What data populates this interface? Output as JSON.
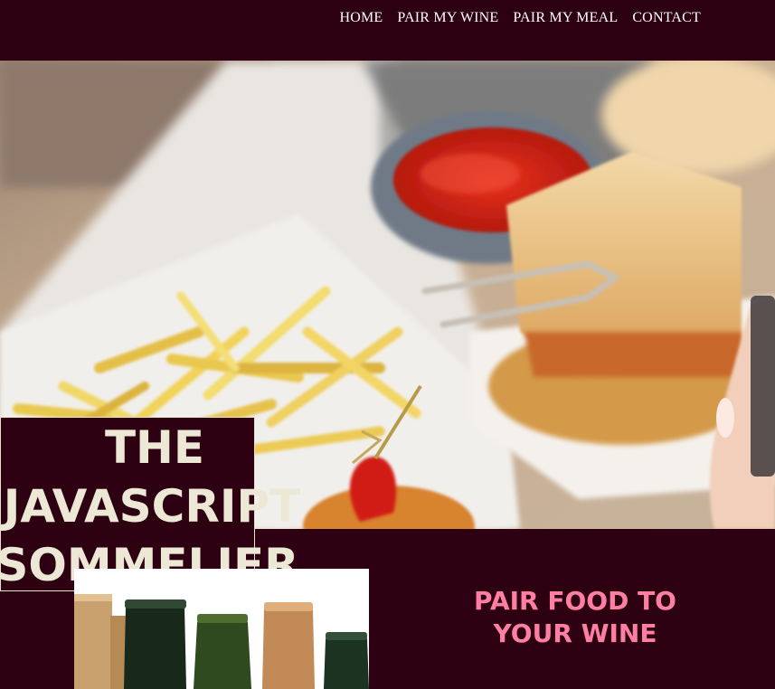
{
  "nav": {
    "items": [
      {
        "label": "HOME"
      },
      {
        "label": "PAIR MY WINE"
      },
      {
        "label": "PAIR MY MEAL"
      },
      {
        "label": "CONTACT"
      }
    ]
  },
  "hero": {
    "title_lines": [
      "THE",
      "JAVASCRIPT",
      "SOMMELIER"
    ]
  },
  "pair_section": {
    "heading_lines": [
      "PAIR FOOD TO",
      "YOUR WINE"
    ]
  },
  "colors": {
    "background": "#2d0012",
    "title_text": "#ede8d6",
    "accent_pink": "#ff7fa3",
    "nav_text": "#ffffff"
  }
}
